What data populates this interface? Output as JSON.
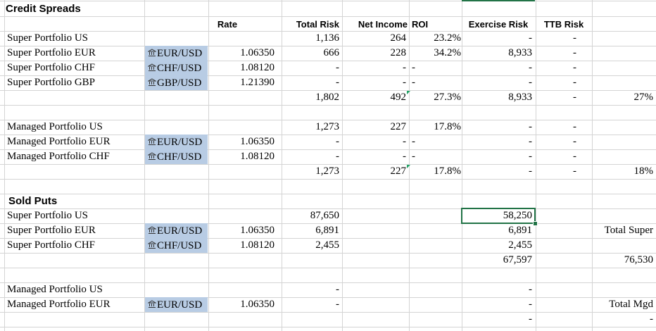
{
  "sheet": {
    "colors": {
      "gridline": "#d4d4d4",
      "fx_fill": "#b8cce4",
      "selection": "#217346",
      "error_flag": "#21a366"
    },
    "headers": {
      "rate": "Rate",
      "total_risk": "Total Risk",
      "net_income": "Net Income",
      "roi": "ROI",
      "exercise_risk": "Exercise Risk",
      "ttb_risk": "TTB Risk"
    },
    "sections": {
      "credit_spreads": "Credit Spreads",
      "sold_puts": "Sold Puts"
    },
    "rows": [
      {
        "label": "Super Portfolio US",
        "fx": "",
        "rate": "",
        "total_risk": "1,136",
        "net_income": "264",
        "roi": "23.2%",
        "exercise_risk": "-",
        "ttb_risk": "-",
        "extra": ""
      },
      {
        "label": "Super Portfolio EUR",
        "fx": "EUR/USD",
        "rate": "1.06350",
        "total_risk": "666",
        "net_income": "228",
        "roi": "34.2%",
        "exercise_risk": "8,933",
        "ttb_risk": "-",
        "extra": ""
      },
      {
        "label": "Super Portfolio CHF",
        "fx": "CHF/USD",
        "rate": "1.08120",
        "total_risk": "-",
        "net_income": "-",
        "roi": "-",
        "exercise_risk": "-",
        "ttb_risk": "-",
        "extra": ""
      },
      {
        "label": "Super Portfolio GBP",
        "fx": "GBP/USD",
        "rate": "1.21390",
        "total_risk": "-",
        "net_income": "-",
        "roi": "-",
        "exercise_risk": "-",
        "ttb_risk": "-",
        "extra": ""
      },
      {
        "label": "",
        "fx": "",
        "rate": "",
        "total_risk": "1,802",
        "net_income": "492",
        "roi": "27.3%",
        "exercise_risk": "8,933",
        "ttb_risk": "-",
        "extra": "27%"
      },
      {
        "label": "",
        "fx": "",
        "rate": "",
        "total_risk": "",
        "net_income": "",
        "roi": "",
        "exercise_risk": "",
        "ttb_risk": "",
        "extra": ""
      },
      {
        "label": "Managed Portfolio US",
        "fx": "",
        "rate": "",
        "total_risk": "1,273",
        "net_income": "227",
        "roi": "17.8%",
        "exercise_risk": "-",
        "ttb_risk": "-",
        "extra": ""
      },
      {
        "label": "Managed Portfolio EUR",
        "fx": "EUR/USD",
        "rate": "1.06350",
        "total_risk": "-",
        "net_income": "-",
        "roi": "-",
        "exercise_risk": "-",
        "ttb_risk": "-",
        "extra": ""
      },
      {
        "label": "Managed Portfolio CHF",
        "fx": "CHF/USD",
        "rate": "1.08120",
        "total_risk": "-",
        "net_income": "-",
        "roi": "-",
        "exercise_risk": "-",
        "ttb_risk": "-",
        "extra": ""
      },
      {
        "label": "",
        "fx": "",
        "rate": "",
        "total_risk": "1,273",
        "net_income": "227",
        "roi": "17.8%",
        "exercise_risk": "-",
        "ttb_risk": "-",
        "extra": "18%"
      },
      {
        "label": "",
        "fx": "",
        "rate": "",
        "total_risk": "",
        "net_income": "",
        "roi": "",
        "exercise_risk": "",
        "ttb_risk": "",
        "extra": ""
      },
      {
        "label": "",
        "fx": "",
        "rate": "",
        "total_risk": "",
        "net_income": "",
        "roi": "",
        "exercise_risk": "",
        "ttb_risk": "",
        "extra": ""
      },
      {
        "label": "Super Portfolio US",
        "fx": "",
        "rate": "",
        "total_risk": "87,650",
        "net_income": "",
        "roi": "",
        "exercise_risk": "58,250",
        "ttb_risk": "",
        "extra": ""
      },
      {
        "label": "Super Portfolio EUR",
        "fx": "EUR/USD",
        "rate": "1.06350",
        "total_risk": "6,891",
        "net_income": "",
        "roi": "",
        "exercise_risk": "6,891",
        "ttb_risk": "",
        "extra": "Total Super"
      },
      {
        "label": "Super Portfolio CHF",
        "fx": "CHF/USD",
        "rate": "1.08120",
        "total_risk": "2,455",
        "net_income": "",
        "roi": "",
        "exercise_risk": "2,455",
        "ttb_risk": "",
        "extra": ""
      },
      {
        "label": "",
        "fx": "",
        "rate": "",
        "total_risk": "",
        "net_income": "",
        "roi": "",
        "exercise_risk": "67,597",
        "ttb_risk": "",
        "extra": "76,530"
      },
      {
        "label": "",
        "fx": "",
        "rate": "",
        "total_risk": "",
        "net_income": "",
        "roi": "",
        "exercise_risk": "",
        "ttb_risk": "",
        "extra": ""
      },
      {
        "label": "Managed Portfolio US",
        "fx": "",
        "rate": "",
        "total_risk": "-",
        "net_income": "",
        "roi": "",
        "exercise_risk": "-",
        "ttb_risk": "",
        "extra": ""
      },
      {
        "label": "Managed Portfolio EUR",
        "fx": "EUR/USD",
        "rate": "1.06350",
        "total_risk": "-",
        "net_income": "",
        "roi": "",
        "exercise_risk": "-",
        "ttb_risk": "",
        "extra": "Total Mgd"
      },
      {
        "label": "",
        "fx": "",
        "rate": "",
        "total_risk": "",
        "net_income": "",
        "roi": "",
        "exercise_risk": "-",
        "ttb_risk": "",
        "extra": "-"
      }
    ],
    "fx_icon": "bank-icon",
    "error_flag_icon": "error-flag-icon",
    "selected_cell": "58,250"
  }
}
